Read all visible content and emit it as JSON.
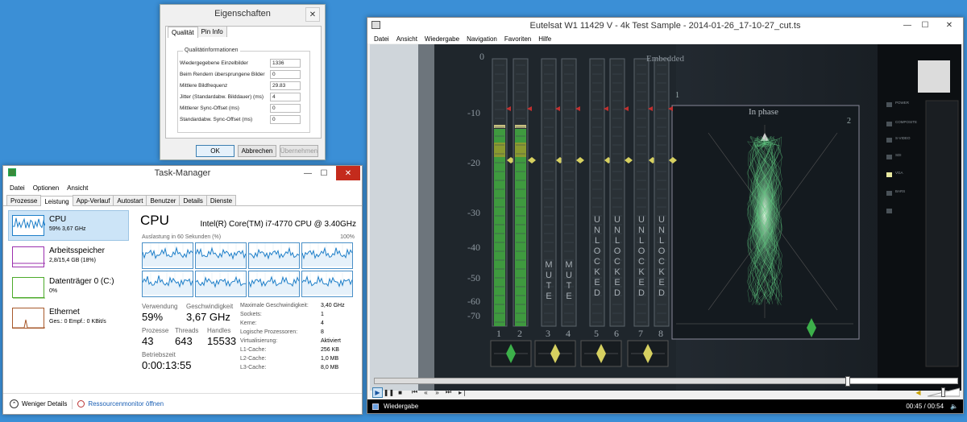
{
  "props": {
    "title": "Eigenschaften",
    "tabs": [
      "Qualität",
      "Pin Info"
    ],
    "group_title": "Qualitätinformationen",
    "rows": [
      {
        "label": "Wiedergegebene Einzelbilder",
        "value": "1336"
      },
      {
        "label": "Beim Rendern übersprungene Bilder",
        "value": "0"
      },
      {
        "label": "Mittlere Bildfrequenz",
        "value": "29.83"
      },
      {
        "label": "Jitter (Standardabw. Bilddauer) (ms)",
        "value": "4"
      },
      {
        "label": "Mittlerer Sync-Offset (ms)",
        "value": "0"
      },
      {
        "label": "Standardabw. Sync-Offset (ms)",
        "value": "0"
      }
    ],
    "ok": "OK",
    "cancel": "Abbrechen",
    "apply": "Übernehmen",
    "close": "✕"
  },
  "tm": {
    "title": "Task-Manager",
    "menu": [
      "Datei",
      "Optionen",
      "Ansicht"
    ],
    "tabs": [
      "Prozesse",
      "Leistung",
      "App-Verlauf",
      "Autostart",
      "Benutzer",
      "Details",
      "Dienste"
    ],
    "side": [
      {
        "name": "CPU",
        "sub": "59% 3,67 GHz",
        "color": "#1e7fc9"
      },
      {
        "name": "Arbeitsspeicher",
        "sub": "2,8/15,4 GB (18%)",
        "color": "#9b2fae"
      },
      {
        "name": "Datenträger 0 (C:)",
        "sub": "0%",
        "color": "#4caa2a"
      },
      {
        "name": "Ethernet",
        "sub": "Ges.: 0 Empf.: 0 KBit/s",
        "color": "#a7592b"
      }
    ],
    "heading": "CPU",
    "cpu_model": "Intel(R) Core(TM) i7-4770 CPU @ 3.40GHz",
    "graph_label": "Auslastung in 60 Sekunden (%)",
    "graph_max": "100%",
    "stats": {
      "usage_label": "Verwendung",
      "usage": "59%",
      "speed_label": "Geschwindigkeit",
      "speed": "3,67 GHz",
      "proc_label": "Prozesse",
      "proc": "43",
      "threads_label": "Threads",
      "threads": "643",
      "handles_label": "Handles",
      "handles": "15533",
      "uptime_label": "Betriebszeit",
      "uptime": "0:00:13:55"
    },
    "details": [
      {
        "k": "Maximale Geschwindigkeit:",
        "v": "3,40 GHz"
      },
      {
        "k": "Sockets:",
        "v": "1"
      },
      {
        "k": "Kerne:",
        "v": "4"
      },
      {
        "k": "Logische Prozessoren:",
        "v": "8"
      },
      {
        "k": "Virtualisierung:",
        "v": "Aktiviert"
      },
      {
        "k": "L1-Cache:",
        "v": "256 KB"
      },
      {
        "k": "L2-Cache:",
        "v": "1,0 MB"
      },
      {
        "k": "L3-Cache:",
        "v": "8,0 MB"
      }
    ],
    "fewer": "Weniger Details",
    "monitor": "Ressourcenmonitor öffnen",
    "minimize": "—",
    "maximize": "☐",
    "close": "✕"
  },
  "player": {
    "title": "Eutelsat W1 11429 V - 4k Test Sample - 2014-01-26_17-10-27_cut.ts",
    "menu": [
      "Datei",
      "Ansicht",
      "Wiedergabe",
      "Navigation",
      "Favoriten",
      "Hilfe"
    ],
    "status": "Wiedergabe",
    "time": "00:45 / 00:54",
    "progress": 0.81,
    "volume": 0.5,
    "video": {
      "embedded": "Embedded",
      "in_phase": "In phase",
      "scale": [
        "0",
        "-10",
        "-20",
        "-30",
        "-40",
        "-50",
        "-60",
        "-70"
      ],
      "channels": [
        "1",
        "2",
        "3",
        "4",
        "5",
        "6",
        "7",
        "8"
      ],
      "mute": "MUTE",
      "unlocked": "UNLOCKED",
      "corner1": "1",
      "corner2": "2",
      "panel_labels": [
        "POWER",
        "COMPOSITE",
        "S-VIDEO",
        "SDI",
        "VGA",
        "BARS"
      ]
    },
    "minimize": "—",
    "maximize": "☐",
    "close": "✕"
  }
}
